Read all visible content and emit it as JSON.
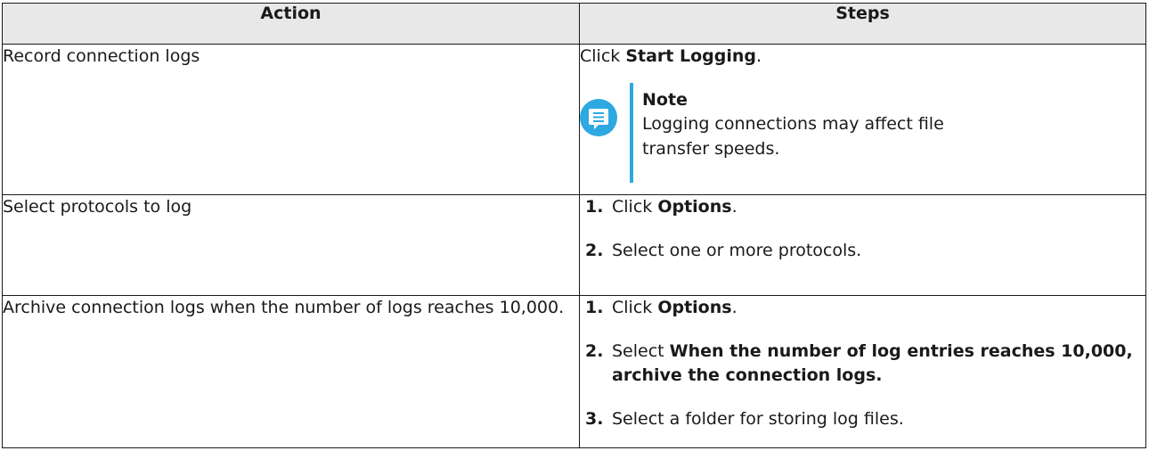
{
  "table": {
    "headers": {
      "action": "Action",
      "steps": "Steps"
    },
    "rows": [
      {
        "action": "Record connection logs",
        "steps": {
          "prefix": "Click ",
          "bold": "Start Logging",
          "suffix": "."
        },
        "note": {
          "icon": "note-speech-icon",
          "title": "Note",
          "text": "Logging connections may affect file transfer speeds."
        }
      },
      {
        "action": "Select protocols to log",
        "steps": [
          {
            "num": "1.",
            "prefix": "Click ",
            "bold": "Options",
            "suffix": "."
          },
          {
            "num": "2.",
            "text": "Select one or more protocols."
          }
        ]
      },
      {
        "action": "Archive connection logs when the number of logs reaches 10,000.",
        "steps": [
          {
            "num": "1.",
            "prefix": "Click ",
            "bold": "Options",
            "suffix": "."
          },
          {
            "num": "2.",
            "prefix": "Select ",
            "bold": "When the number of log entries reaches 10,000, archive the connection logs."
          },
          {
            "num": "3.",
            "text": "Select a folder for storing log files."
          }
        ]
      }
    ]
  },
  "colors": {
    "accent": "#2ea8e0",
    "header_bg": "#e8e8e8",
    "border": "#1a1a1a"
  }
}
